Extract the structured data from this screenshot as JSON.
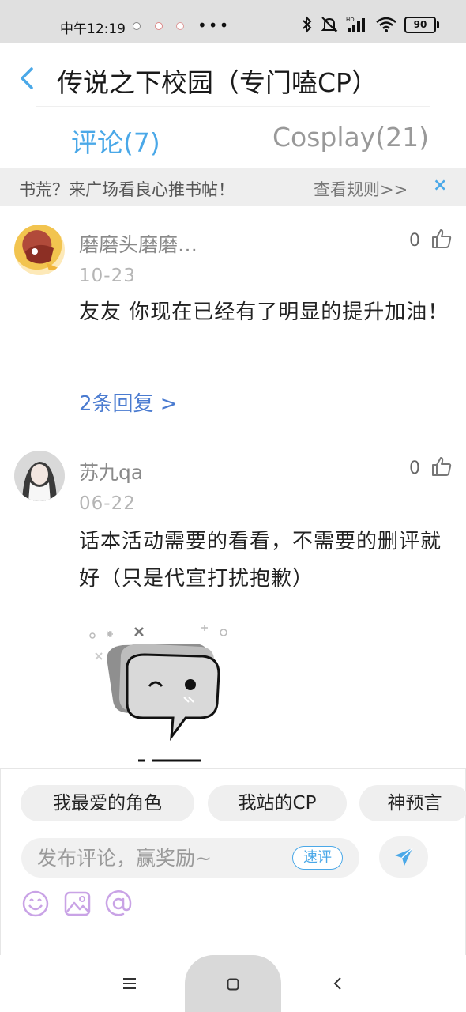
{
  "status_bar": {
    "time": "中午12:19",
    "dots": "•••",
    "battery": "90",
    "icons": [
      "notification-icon",
      "notification-icon",
      "notification-icon",
      "bluetooth-icon",
      "mute-icon",
      "signal-icon",
      "wifi-icon",
      "battery-icon"
    ]
  },
  "header": {
    "back_icon": "chevron-left-icon",
    "title": "传说之下校园（专门嗑CP）"
  },
  "tabs": [
    {
      "label": "评论(7)",
      "active": true
    },
    {
      "label": "Cosplay(21)",
      "active": false
    }
  ],
  "banner": {
    "text": "书荒？来广场看良心推书帖！",
    "link": "查看规则>>",
    "close": "×"
  },
  "comments": [
    {
      "username": "磨磨头磨磨…",
      "likes": "0",
      "date": "10-23",
      "content": "友友 你现在已经有了明显的提升加油！",
      "replies": "2条回复 >"
    },
    {
      "username": "苏九qa",
      "likes": "0",
      "date": "06-22",
      "content": "话本活动需要的看看，不需要的删评就好（只是代宣打扰抱歉）",
      "sticker": "speech-bubble-sticker"
    }
  ],
  "composer": {
    "chips": [
      "我最爱的角色",
      "我站的CP",
      "神预言"
    ],
    "input_placeholder": "发布评论，赢奖励~",
    "quick_label": "速评",
    "send_icon": "send-icon",
    "tools": [
      "emoji-icon",
      "image-icon",
      "at-icon"
    ]
  },
  "navbar": {
    "icons": [
      "menu-icon",
      "home-icon",
      "back-icon"
    ]
  },
  "colors": {
    "accent": "#4aa8e8",
    "reply_link": "#4a7bd0",
    "tool_icon": "#c9a3e6"
  }
}
